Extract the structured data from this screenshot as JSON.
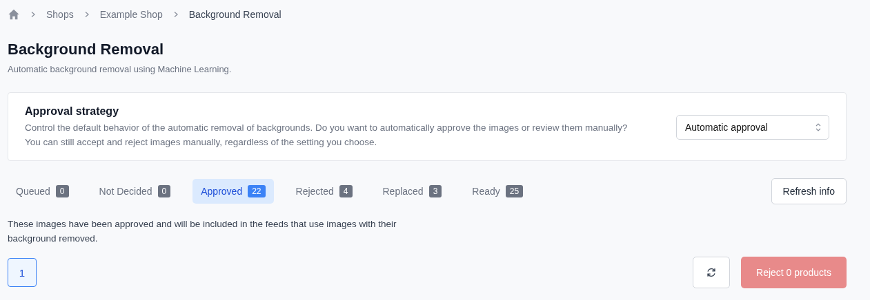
{
  "breadcrumb": [
    "Shops",
    "Example Shop",
    "Background Removal"
  ],
  "header": {
    "title": "Background Removal",
    "subtitle": "Automatic background removal using Machine Learning."
  },
  "approval_strategy": {
    "title": "Approval strategy",
    "description": "Control the default behavior of the automatic removal of backgrounds. Do you want to automatically approve the images or review them manually? You can still accept and reject images manually, regardless of the setting you choose.",
    "select_value": "Automatic approval"
  },
  "tabs": [
    {
      "label": "Queued",
      "count": "0",
      "selected": false
    },
    {
      "label": "Not Decided",
      "count": "0",
      "selected": false
    },
    {
      "label": "Approved",
      "count": "22",
      "selected": true
    },
    {
      "label": "Rejected",
      "count": "4",
      "selected": false
    },
    {
      "label": "Replaced",
      "count": "3",
      "selected": false
    },
    {
      "label": "Ready",
      "count": "25",
      "selected": false
    }
  ],
  "refresh_button": "Refresh info",
  "tab_description": "These images have been approved and will be included in the feeds that use images with their background removed.",
  "pagination": [
    {
      "label": "1",
      "selected": true
    }
  ],
  "reject_button": {
    "label": "Reject 0 products",
    "disabled": true
  }
}
